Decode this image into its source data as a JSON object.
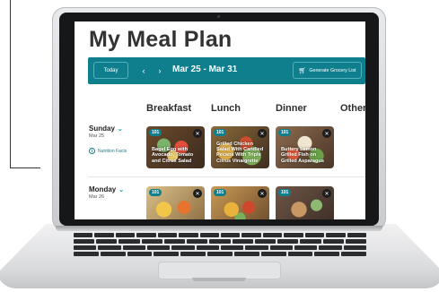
{
  "app": {
    "title": "My Meal Plan"
  },
  "toolbar": {
    "today_label": "Today",
    "prev_label": "‹",
    "next_label": "›",
    "date_range": "Mar 25 - Mar 31",
    "grocery_label": "Generate Grocery List"
  },
  "columns": [
    "Breakfast",
    "Lunch",
    "Dinner",
    "Other"
  ],
  "days": [
    {
      "name": "Sunday",
      "date": "Mar 25",
      "nutrition_label": "Nutrition Facts",
      "meals": [
        {
          "badge": "101",
          "caption": "Bagel Egg with Avocado, Tomato and Citrus Salad"
        },
        {
          "badge": "101",
          "caption": "Grilled Chicken Salad With Candied Pecans With Triple Citrus Vinaigrette"
        },
        {
          "badge": "101",
          "caption": "Buttery Lemon Grilled Fish on Grilled Asparagus"
        }
      ]
    },
    {
      "name": "Monday",
      "date": "Mar 26",
      "meals": [
        {
          "badge": "101"
        },
        {
          "badge": "101"
        },
        {
          "badge": "101"
        }
      ]
    }
  ],
  "colors": {
    "accent": "#0f7f8d",
    "title": "#333333"
  },
  "icons": {
    "close": "close-icon",
    "chevron": "chevron-down-icon",
    "info": "info-icon",
    "cart": "cart-icon"
  }
}
